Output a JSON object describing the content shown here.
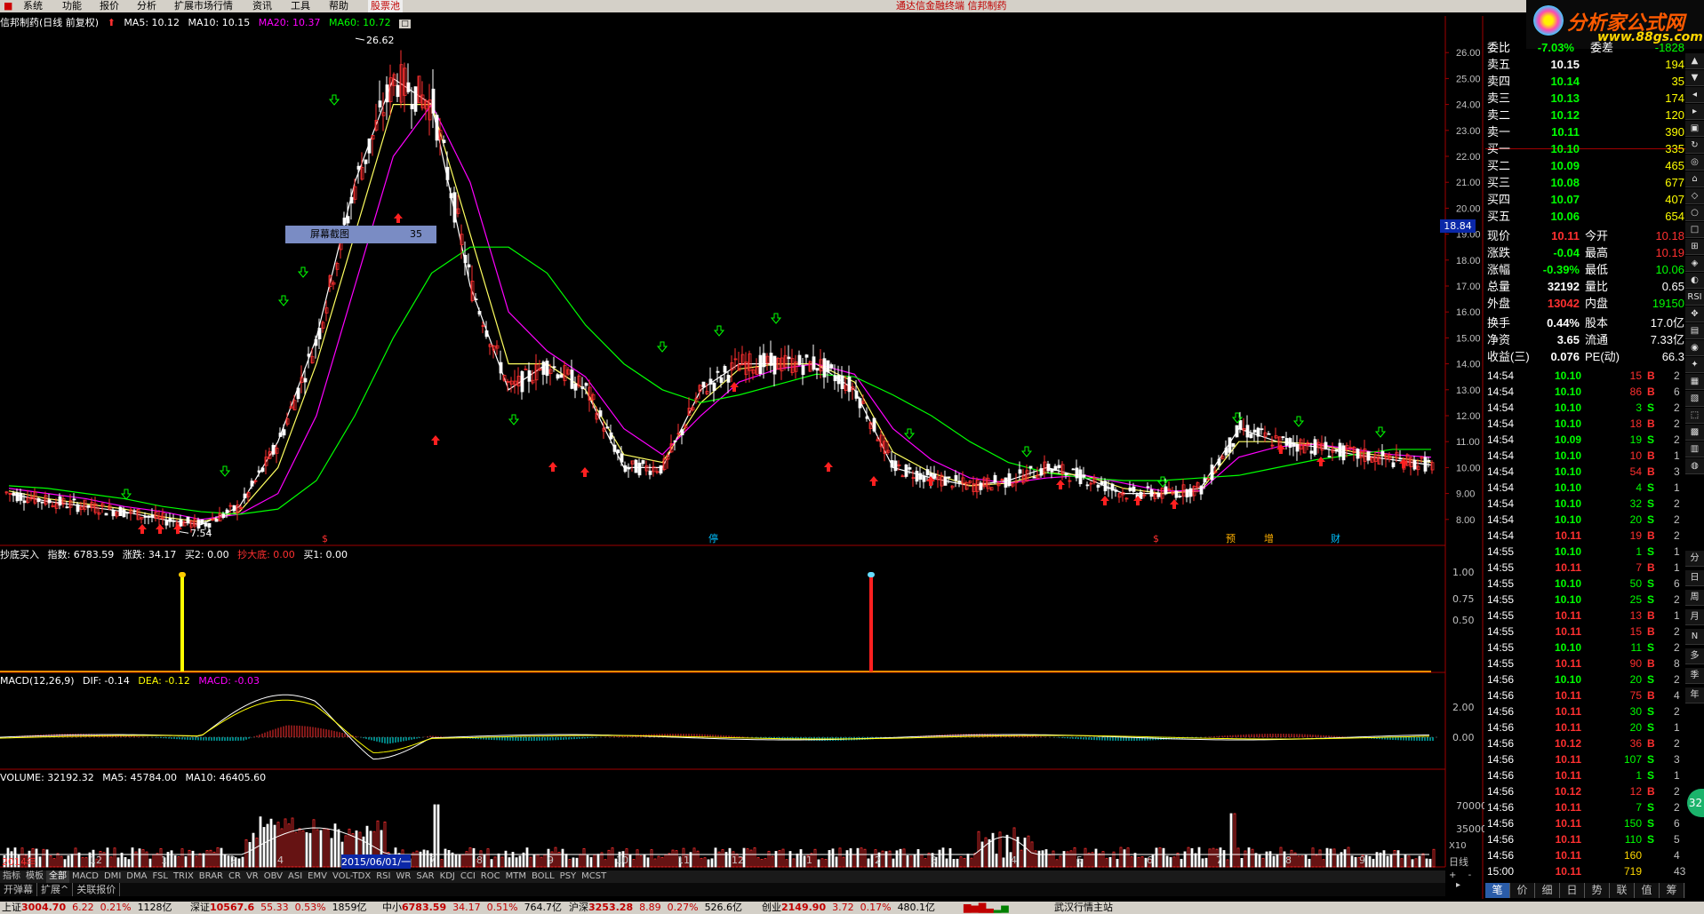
{
  "menu": [
    "系统",
    "功能",
    "报价",
    "分析",
    "扩展市场行情",
    "资讯",
    "工具",
    "帮助"
  ],
  "menu_highlight": "股票池",
  "center_title": "通达信金融终端   信邦制药",
  "logo": {
    "title": "分析家公式网",
    "url": "www.88gs.com"
  },
  "chart_header": {
    "name": "信邦制药(日线 前复权)",
    "ma5": "MA5: 10.12",
    "ma10": "MA10: 10.15",
    "ma20": "MA20: 10.37",
    "ma60": "MA60: 10.72"
  },
  "price_axis": [
    "26.00",
    "25.00",
    "24.00",
    "23.00",
    "22.00",
    "21.00",
    "20.00",
    "19.00",
    "18.00",
    "17.00",
    "16.00",
    "15.00",
    "14.00",
    "13.00",
    "12.00",
    "11.00",
    "10.00",
    "9.00",
    "8.00"
  ],
  "price_marker": "18.84",
  "annotations": {
    "high": "26.62",
    "low": "7.54"
  },
  "popup": {
    "label": "屏幕截图",
    "value": "35"
  },
  "event_labels": [
    {
      "text": "$",
      "color": "#ff3030"
    },
    {
      "text": "停",
      "color": "#00c0ff"
    },
    {
      "text": "$",
      "color": "#ff3030"
    },
    {
      "text": "预",
      "color": "#ffb000"
    },
    {
      "text": "增",
      "color": "#ffb000"
    },
    {
      "text": "财",
      "color": "#00c0ff"
    }
  ],
  "ind1": {
    "name": "抄底买入",
    "idx": "指数: 6783.59",
    "zd": "涨跌: 34.17",
    "b2": "买2: 0.00",
    "cdd": "抄大底: 0.00",
    "b1": "买1: 0.00",
    "axis": [
      "1.00",
      "0.75",
      "0.50"
    ]
  },
  "macd": {
    "name": "MACD(12,26,9)",
    "dif": "DIF: -0.14",
    "dea": "DEA: -0.12",
    "macd": "MACD: -0.03",
    "axis": [
      "2.00",
      "0.00"
    ]
  },
  "volume": {
    "name": "VOLUME: 32192.32",
    "ma5": "MA5: 45784.00",
    "ma10": "MA10: 46405.60",
    "axis": [
      "70000",
      "35000"
    ],
    "unit": "X10"
  },
  "xaxis": [
    {
      "t": "2014年",
      "c": "#ff3030"
    },
    {
      "t": "12",
      "c": "#c0c0c0"
    },
    {
      "t": "1",
      "c": "#c0c0c0"
    },
    {
      "t": "2",
      "c": "#c0c0c0"
    },
    {
      "t": "4",
      "c": "#c0c0c0"
    },
    {
      "t": "2015/06/01/一",
      "c": "#ffffff"
    },
    {
      "t": "7",
      "c": "#c0c0c0"
    },
    {
      "t": "8",
      "c": "#c0c0c0"
    },
    {
      "t": "9",
      "c": "#c0c0c0"
    },
    {
      "t": "10",
      "c": "#c0c0c0"
    },
    {
      "t": "11",
      "c": "#c0c0c0"
    },
    {
      "t": "12",
      "c": "#c0c0c0"
    },
    {
      "t": "1",
      "c": "#c0c0c0"
    },
    {
      "t": "2",
      "c": "#c0c0c0"
    },
    {
      "t": "3",
      "c": "#c0c0c0"
    },
    {
      "t": "4",
      "c": "#c0c0c0"
    },
    {
      "t": "5",
      "c": "#c0c0c0"
    },
    {
      "t": "6",
      "c": "#c0c0c0"
    },
    {
      "t": "7",
      "c": "#c0c0c0"
    },
    {
      "t": "8",
      "c": "#c0c0c0"
    },
    {
      "t": "9",
      "c": "#c0c0c0"
    }
  ],
  "period": "日线",
  "indicator_tabs": [
    "指标",
    "模板",
    "全部",
    "MACD",
    "DMI",
    "DMA",
    "FSL",
    "TRIX",
    "BRAR",
    "CR",
    "VR",
    "OBV",
    "ASI",
    "EMV",
    "VOL-TDX",
    "RSI",
    "WR",
    "SAR",
    "KDJ",
    "CCI",
    "ROC",
    "MTM",
    "BOLL",
    "PSY",
    "MCST"
  ],
  "sub_tabs": [
    "开弹幕",
    "扩展^",
    "关联报价"
  ],
  "quote": {
    "weibi": {
      "label": "委比",
      "value": "-7.03%",
      "label2": "委差",
      "value2": "-1828"
    },
    "sells": [
      {
        "l": "卖五",
        "p": "10.15",
        "v": "194"
      },
      {
        "l": "卖四",
        "p": "10.14",
        "v": "35"
      },
      {
        "l": "卖三",
        "p": "10.13",
        "v": "174"
      },
      {
        "l": "卖二",
        "p": "10.12",
        "v": "120"
      },
      {
        "l": "卖一",
        "p": "10.11",
        "v": "390"
      }
    ],
    "buys": [
      {
        "l": "买一",
        "p": "10.10",
        "v": "335"
      },
      {
        "l": "买二",
        "p": "10.09",
        "v": "465"
      },
      {
        "l": "买三",
        "p": "10.08",
        "v": "677"
      },
      {
        "l": "买四",
        "p": "10.07",
        "v": "407"
      },
      {
        "l": "买五",
        "p": "10.06",
        "v": "654"
      }
    ],
    "stats": [
      {
        "l": "现价",
        "v": "10.11",
        "vc": "#ff3030",
        "l2": "今开",
        "v2": "10.18",
        "v2c": "#ff3030"
      },
      {
        "l": "涨跌",
        "v": "-0.04",
        "vc": "#00ff00",
        "l2": "最高",
        "v2": "10.19",
        "v2c": "#ff3030"
      },
      {
        "l": "涨幅",
        "v": "-0.39%",
        "vc": "#00ff00",
        "l2": "最低",
        "v2": "10.06",
        "v2c": "#00ff00"
      },
      {
        "l": "总量",
        "v": "32192",
        "vc": "#ffffff",
        "l2": "量比",
        "v2": "0.65",
        "v2c": "#ffffff"
      },
      {
        "l": "外盘",
        "v": "13042",
        "vc": "#ff3030",
        "l2": "内盘",
        "v2": "19150",
        "v2c": "#00ff00"
      },
      {
        "l": "换手",
        "v": "0.44%",
        "vc": "#ffffff",
        "l2": "股本",
        "v2": "17.0亿",
        "v2c": "#ffffff"
      },
      {
        "l": "净资",
        "v": "3.65",
        "vc": "#ffffff",
        "l2": "流通",
        "v2": "7.33亿",
        "v2c": "#ffffff"
      },
      {
        "l": "收益(三)",
        "v": "0.076",
        "vc": "#ffffff",
        "l2": "PE(动)",
        "v2": "66.3",
        "v2c": "#ffffff"
      }
    ],
    "trades": [
      {
        "t": "14:54",
        "p": "10.10",
        "v": "15",
        "bs": "B",
        "n": "2"
      },
      {
        "t": "14:54",
        "p": "10.10",
        "v": "86",
        "bs": "B",
        "n": "6"
      },
      {
        "t": "14:54",
        "p": "10.10",
        "v": "3",
        "bs": "S",
        "n": "2"
      },
      {
        "t": "14:54",
        "p": "10.10",
        "v": "18",
        "bs": "B",
        "n": "2"
      },
      {
        "t": "14:54",
        "p": "10.09",
        "v": "19",
        "bs": "S",
        "n": "2"
      },
      {
        "t": "14:54",
        "p": "10.10",
        "v": "10",
        "bs": "B",
        "n": "1"
      },
      {
        "t": "14:54",
        "p": "10.10",
        "v": "54",
        "bs": "B",
        "n": "3"
      },
      {
        "t": "14:54",
        "p": "10.10",
        "v": "4",
        "bs": "S",
        "n": "1"
      },
      {
        "t": "14:54",
        "p": "10.10",
        "v": "32",
        "bs": "S",
        "n": "2"
      },
      {
        "t": "14:54",
        "p": "10.10",
        "v": "20",
        "bs": "S",
        "n": "2"
      },
      {
        "t": "14:54",
        "p": "10.11",
        "v": "19",
        "bs": "B",
        "n": "2"
      },
      {
        "t": "14:55",
        "p": "10.10",
        "v": "1",
        "bs": "S",
        "n": "1"
      },
      {
        "t": "14:55",
        "p": "10.11",
        "v": "7",
        "bs": "B",
        "n": "1"
      },
      {
        "t": "14:55",
        "p": "10.10",
        "v": "50",
        "bs": "S",
        "n": "6"
      },
      {
        "t": "14:55",
        "p": "10.10",
        "v": "25",
        "bs": "S",
        "n": "2"
      },
      {
        "t": "14:55",
        "p": "10.11",
        "v": "13",
        "bs": "B",
        "n": "1"
      },
      {
        "t": "14:55",
        "p": "10.11",
        "v": "15",
        "bs": "B",
        "n": "2"
      },
      {
        "t": "14:55",
        "p": "10.10",
        "v": "11",
        "bs": "S",
        "n": "2"
      },
      {
        "t": "14:55",
        "p": "10.11",
        "v": "90",
        "bs": "B",
        "n": "8"
      },
      {
        "t": "14:56",
        "p": "10.10",
        "v": "20",
        "bs": "S",
        "n": "2"
      },
      {
        "t": "14:56",
        "p": "10.11",
        "v": "75",
        "bs": "B",
        "n": "4"
      },
      {
        "t": "14:56",
        "p": "10.11",
        "v": "30",
        "bs": "S",
        "n": "2"
      },
      {
        "t": "14:56",
        "p": "10.11",
        "v": "20",
        "bs": "S",
        "n": "1"
      },
      {
        "t": "14:56",
        "p": "10.12",
        "v": "36",
        "bs": "B",
        "n": "2"
      },
      {
        "t": "14:56",
        "p": "10.11",
        "v": "107",
        "bs": "S",
        "n": "3"
      },
      {
        "t": "14:56",
        "p": "10.11",
        "v": "1",
        "bs": "S",
        "n": "1"
      },
      {
        "t": "14:56",
        "p": "10.12",
        "v": "12",
        "bs": "B",
        "n": "2"
      },
      {
        "t": "14:56",
        "p": "10.11",
        "v": "7",
        "bs": "S",
        "n": "2"
      },
      {
        "t": "14:56",
        "p": "10.11",
        "v": "150",
        "bs": "S",
        "n": "6"
      },
      {
        "t": "14:56",
        "p": "10.11",
        "v": "110",
        "bs": "S",
        "n": "5"
      },
      {
        "t": "14:56",
        "p": "10.11",
        "v": "160",
        "bs": "",
        "n": "4"
      },
      {
        "t": "15:00",
        "p": "10.11",
        "v": "719",
        "bs": "",
        "n": "43"
      }
    ]
  },
  "right_tabs": [
    "笔",
    "价",
    "细",
    "日",
    "势",
    "联",
    "值",
    "筹"
  ],
  "side_buttons": [
    "分",
    "日",
    "周",
    "月",
    "N",
    "多",
    "季",
    "年"
  ],
  "status": [
    {
      "l": "上证",
      "v": "3004.70",
      "d": "6.22",
      "p": "0.21%",
      "a": "1128亿"
    },
    {
      "l": "深证",
      "v": "10567.6",
      "d": "55.33",
      "p": "0.53%",
      "a": "1859亿"
    },
    {
      "l": "中小",
      "v": "6783.59",
      "d": "34.17",
      "p": "0.51%",
      "a": "764.7亿"
    },
    {
      "l": "沪深",
      "v": "3253.28",
      "d": "8.89",
      "p": "0.27%",
      "a": "526.6亿"
    },
    {
      "l": "创业",
      "v": "2149.90",
      "d": "3.72",
      "p": "0.17%",
      "a": "480.1亿"
    }
  ],
  "status_right": "武汉行情主站",
  "chart_data": {
    "type": "line",
    "series": [
      {
        "name": "MA5",
        "values": [
          9.0,
          8.7,
          8.5,
          8.3,
          8.0,
          7.8,
          8.5,
          11,
          15,
          21,
          25,
          24,
          17,
          13,
          14,
          13,
          10,
          10,
          13,
          14,
          14,
          14,
          13,
          10,
          9.6,
          9.3,
          9.5,
          10,
          9.6,
          9.0,
          9.0,
          9.2,
          11.5,
          11,
          10.8,
          10.5,
          10.3,
          10.1
        ]
      },
      {
        "name": "MA10",
        "values": [
          9.1,
          8.8,
          8.6,
          8.4,
          8.1,
          7.9,
          8.3,
          10,
          14,
          19,
          24,
          24,
          19,
          14,
          14,
          13,
          10.5,
          10.2,
          12.5,
          13.8,
          14,
          14,
          13.3,
          10.6,
          9.8,
          9.3,
          9.4,
          9.8,
          9.7,
          9.2,
          9.0,
          9.1,
          11,
          11,
          10.9,
          10.6,
          10.4,
          10.2
        ]
      },
      {
        "name": "MA20",
        "values": [
          9.2,
          9.0,
          8.8,
          8.5,
          8.3,
          8.0,
          8.2,
          9,
          12,
          17,
          22,
          24,
          21,
          16,
          14.5,
          13.5,
          11.5,
          10.5,
          12,
          13.3,
          13.8,
          14,
          13.6,
          11.5,
          10.3,
          9.6,
          9.4,
          9.6,
          9.7,
          9.4,
          9.1,
          9.1,
          10.4,
          10.8,
          10.9,
          10.7,
          10.5,
          10.4
        ]
      },
      {
        "name": "MA60",
        "values": [
          9.3,
          9.2,
          9.0,
          8.8,
          8.5,
          8.3,
          8.2,
          8.4,
          9.5,
          12,
          15,
          17.5,
          18.5,
          18.5,
          17.5,
          15.5,
          14,
          13,
          12.5,
          12.8,
          13.2,
          13.6,
          13.5,
          12.8,
          12,
          11,
          10.2,
          9.8,
          9.6,
          9.5,
          9.5,
          9.6,
          9.7,
          10.0,
          10.3,
          10.5,
          10.7,
          10.7
        ]
      }
    ],
    "ylim": [
      7.0,
      27.0
    ],
    "high": 26.62,
    "low": 7.54
  }
}
